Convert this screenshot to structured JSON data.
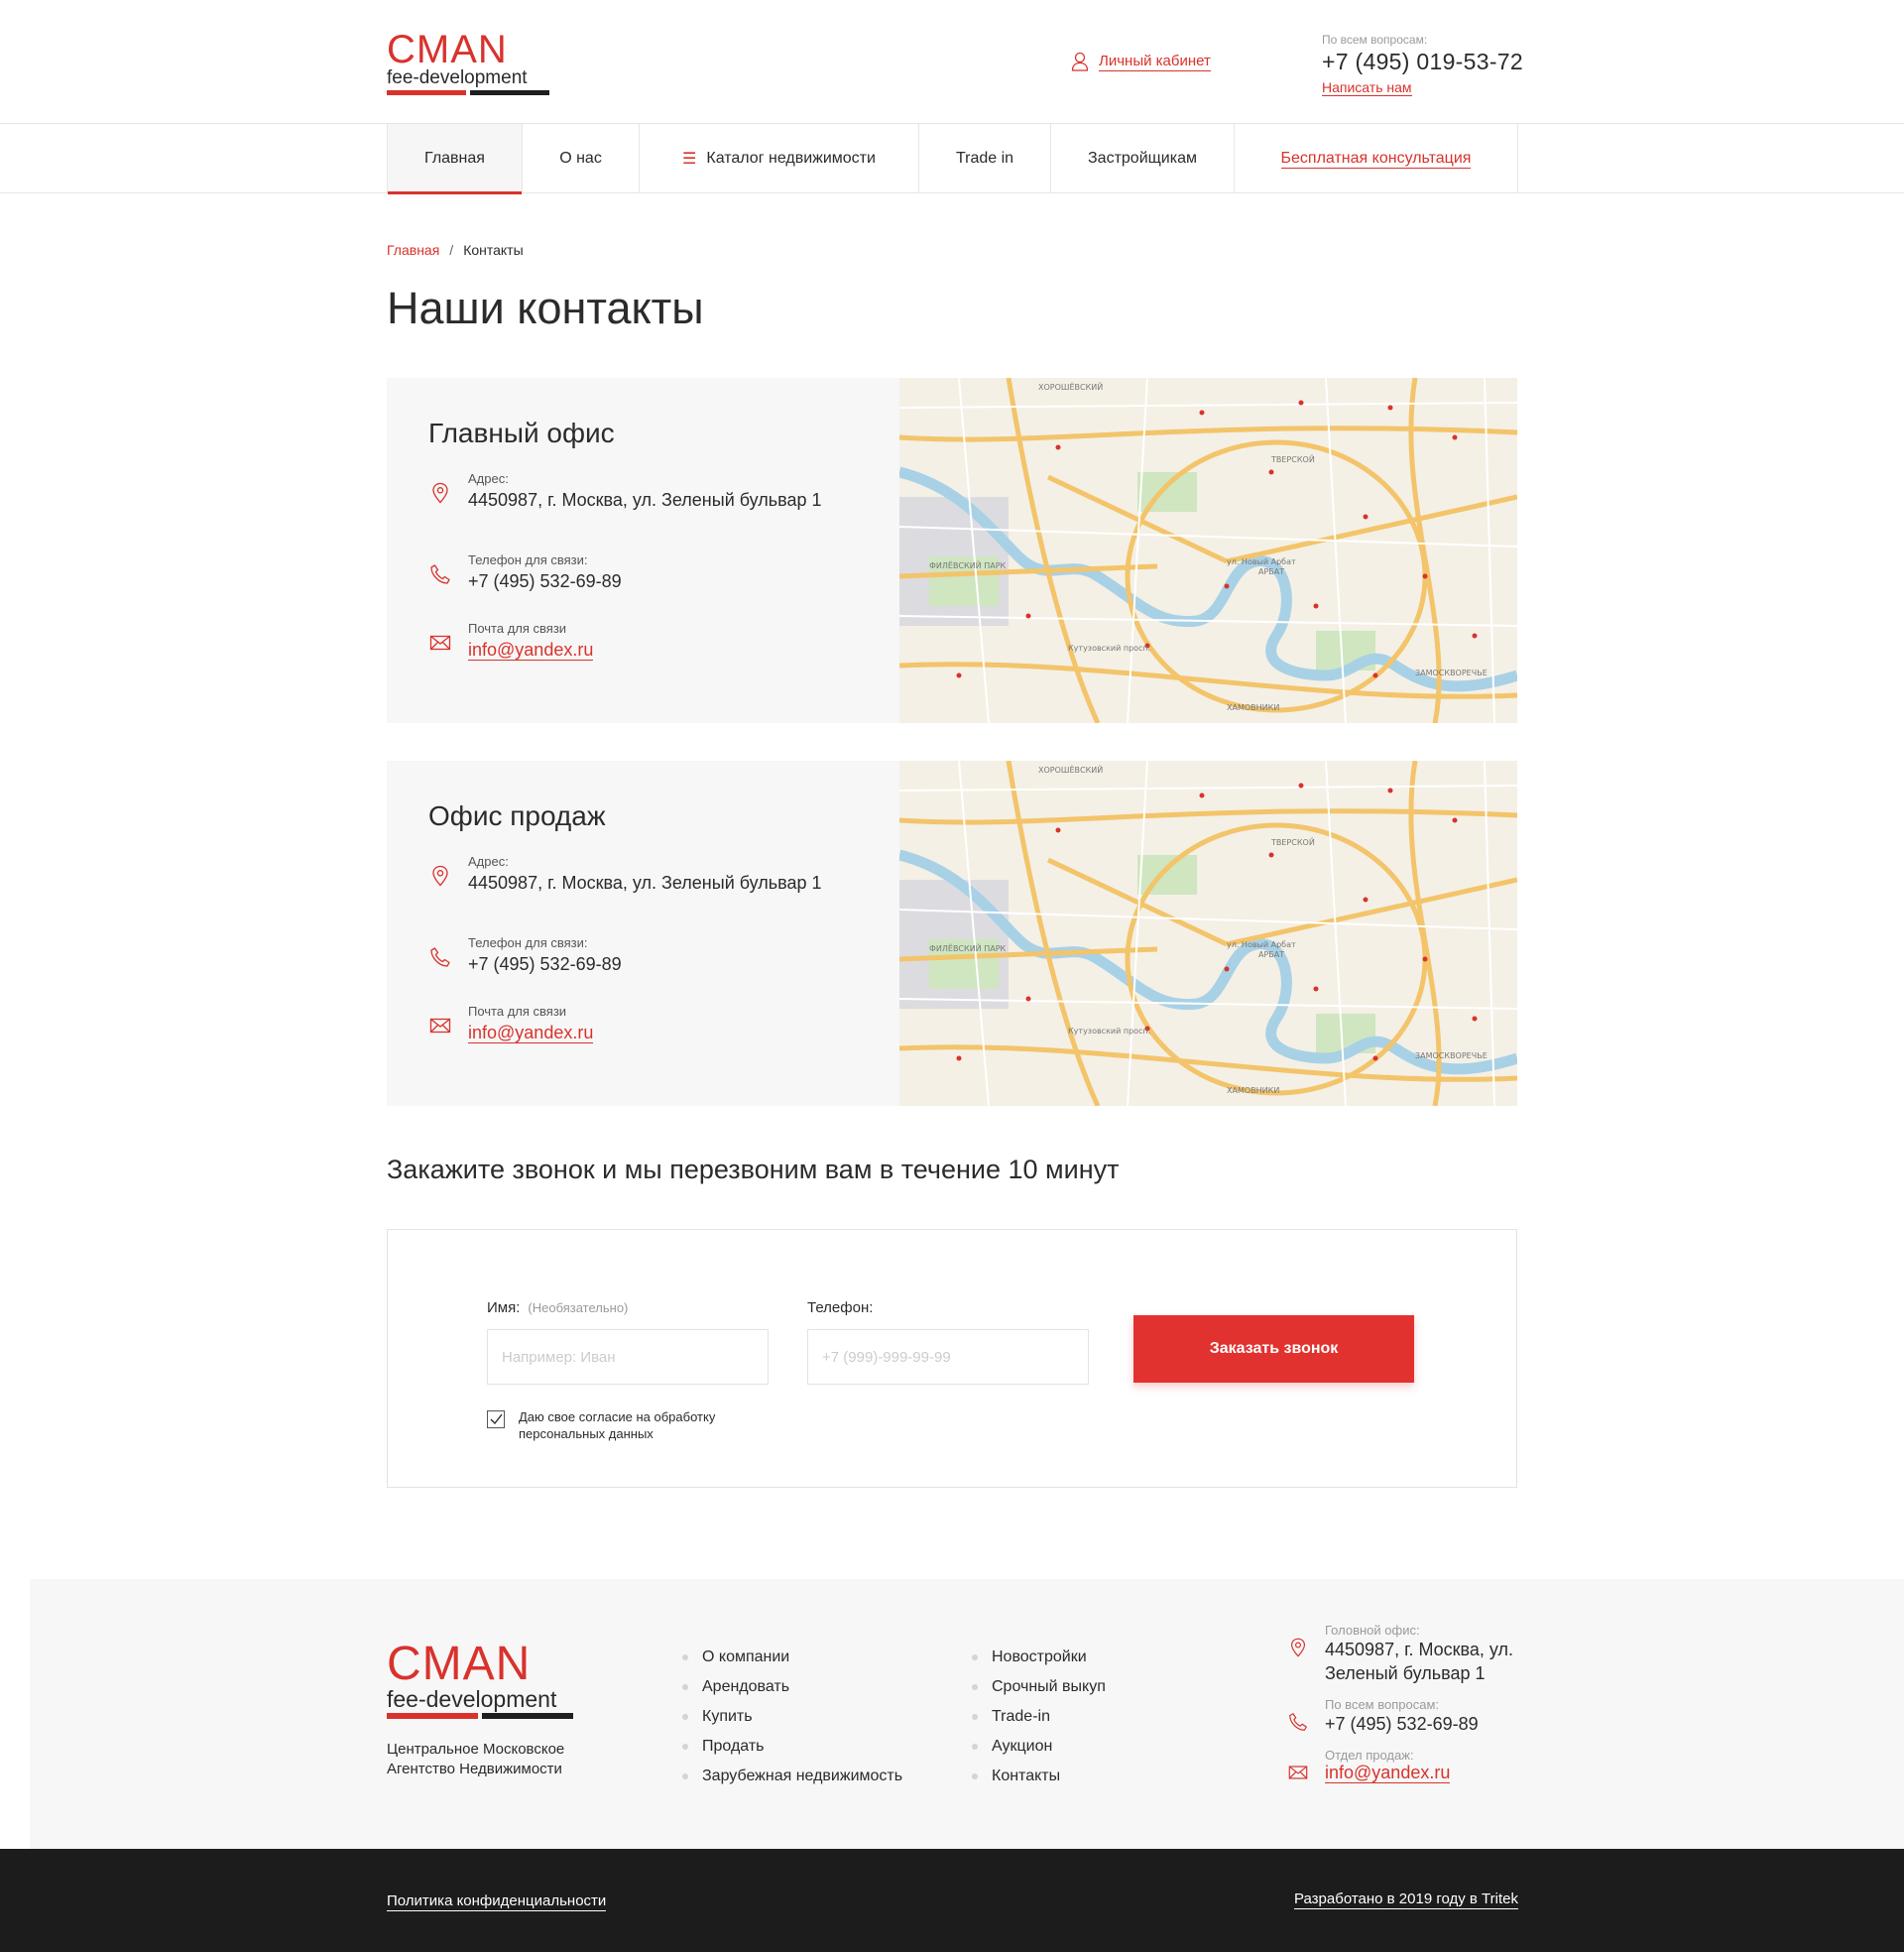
{
  "header": {
    "logo_word": "CMAN",
    "logo_sub": "fee-development",
    "cabinet_label": "Личный кабинет",
    "contact_caption": "По всем вопросам:",
    "phone": "+7 (495) 019-53-72",
    "write_label": "Написать нам"
  },
  "nav": {
    "items": [
      {
        "label": "Главная"
      },
      {
        "label": "О нас"
      },
      {
        "label": "Каталог недвижимости"
      },
      {
        "label": "Trade in"
      },
      {
        "label": "Застройщикам"
      },
      {
        "label": "Бесплатная консультация"
      }
    ]
  },
  "breadcrumb": {
    "home": "Главная",
    "separator": "/",
    "current": "Контакты"
  },
  "page_title": "Наши контакты",
  "offices": [
    {
      "title": "Главный офис",
      "address_caption": "Адрес:",
      "address": "4450987, г. Москва, ул. Зеленый бульвар 1",
      "phone_caption": "Телефон для связи:",
      "phone": "+7 (495) 532-69-89",
      "email_caption": "Почта для связи",
      "email": "info@yandex.ru"
    },
    {
      "title": "Офис продаж",
      "address_caption": "Адрес:",
      "address": "4450987, г. Москва, ул. Зеленый бульвар 1",
      "phone_caption": "Телефон для связи:",
      "phone": "+7 (495) 532-69-89",
      "email_caption": "Почта для связи",
      "email": "info@yandex.ru"
    }
  ],
  "map_labels": [
    "ХОРОШЁВСКИЙ",
    "ФИЛЁВСКИЙ ПАРК",
    "ТВЕРСКОЙ",
    "АРБАТ",
    "ХАМОВНИКИ",
    "ЗАМОСКВОРЕЧЬЕ",
    "ул. Новый Арбат",
    "Кутузовский просп."
  ],
  "callback": {
    "title": "Закажите звонок и мы перезвоним вам в течение 10 минут",
    "name_label": "Имя:",
    "name_optional": "(Необязательно)",
    "name_placeholder": "Например: Иван",
    "phone_label": "Телефон:",
    "phone_placeholder": "+7 (999)-999-99-99",
    "button": "Заказать звонок",
    "agree": "Даю свое согласие на обработку персональных данных"
  },
  "footer": {
    "logo_word": "CMAN",
    "logo_sub": "fee-development",
    "tagline": "Центральное Московское Агентство Недвижимости",
    "col1": [
      "О компании",
      "Арендовать",
      "Купить",
      "Продать",
      "Зарубежная недвижимость"
    ],
    "col2": [
      "Новостройки",
      "Срочный выкуп",
      "Trade-in",
      "Аукцион",
      "Контакты"
    ],
    "office_caption": "Головной офис:",
    "office_address": "4450987, г. Москва, ул. Зеленый бульвар 1",
    "questions_caption": "По всем вопросам:",
    "phone": "+7 (495) 532-69-89",
    "sales_caption": "Отдел продаж:",
    "email": "info@yandex.ru"
  },
  "bottom": {
    "policy": "Политика конфиденциальности",
    "developer": "Разработано в 2019 году в Tritek"
  },
  "colors": {
    "accent": "#d9322c",
    "button": "#e2322f",
    "dark": "#1c1c1c",
    "panel": "#f7f7f7"
  },
  "icons": [
    "user-icon",
    "location-pin-icon",
    "phone-icon",
    "mail-icon",
    "menu-icon",
    "checkmark-icon"
  ]
}
